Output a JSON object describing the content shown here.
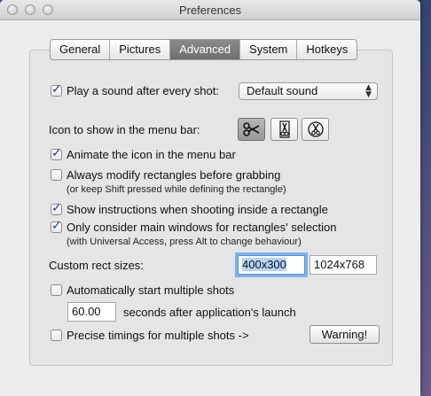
{
  "window": {
    "title": "Preferences"
  },
  "tabs": [
    {
      "label": "General"
    },
    {
      "label": "Pictures"
    },
    {
      "label": "Advanced",
      "active": true
    },
    {
      "label": "System"
    },
    {
      "label": "Hotkeys"
    }
  ],
  "sound": {
    "checkbox_label": "Play a sound after every shot:",
    "checked": true,
    "selected": "Default sound"
  },
  "menubar_icon": {
    "label": "Icon to show in the menu bar:",
    "options": [
      "scissors-icon",
      "scissors-vertical-icon",
      "scissors-circle-icon"
    ],
    "selected_index": 0
  },
  "options": {
    "animate": {
      "label": "Animate the icon in the menu bar",
      "checked": true
    },
    "modify": {
      "label": "Always modify rectangles before grabbing",
      "checked": false,
      "hint": "(or keep Shift pressed while defining the rectangle)"
    },
    "instructions": {
      "label": "Show instructions when shooting inside a rectangle",
      "checked": true
    },
    "main_windows": {
      "label": "Only consider main windows for rectangles' selection",
      "checked": true,
      "hint": "(with Universal Access, press Alt to change behaviour)"
    }
  },
  "rect_sizes": {
    "label": "Custom rect sizes:",
    "size1": "400x300",
    "size2": "1024x768"
  },
  "multiple": {
    "label": "Automatically start multiple shots",
    "checked": false,
    "seconds": "60.00",
    "seconds_label": "seconds after application's launch"
  },
  "precise": {
    "label": "Precise timings for multiple shots ->",
    "checked": false,
    "button": "Warning!"
  }
}
